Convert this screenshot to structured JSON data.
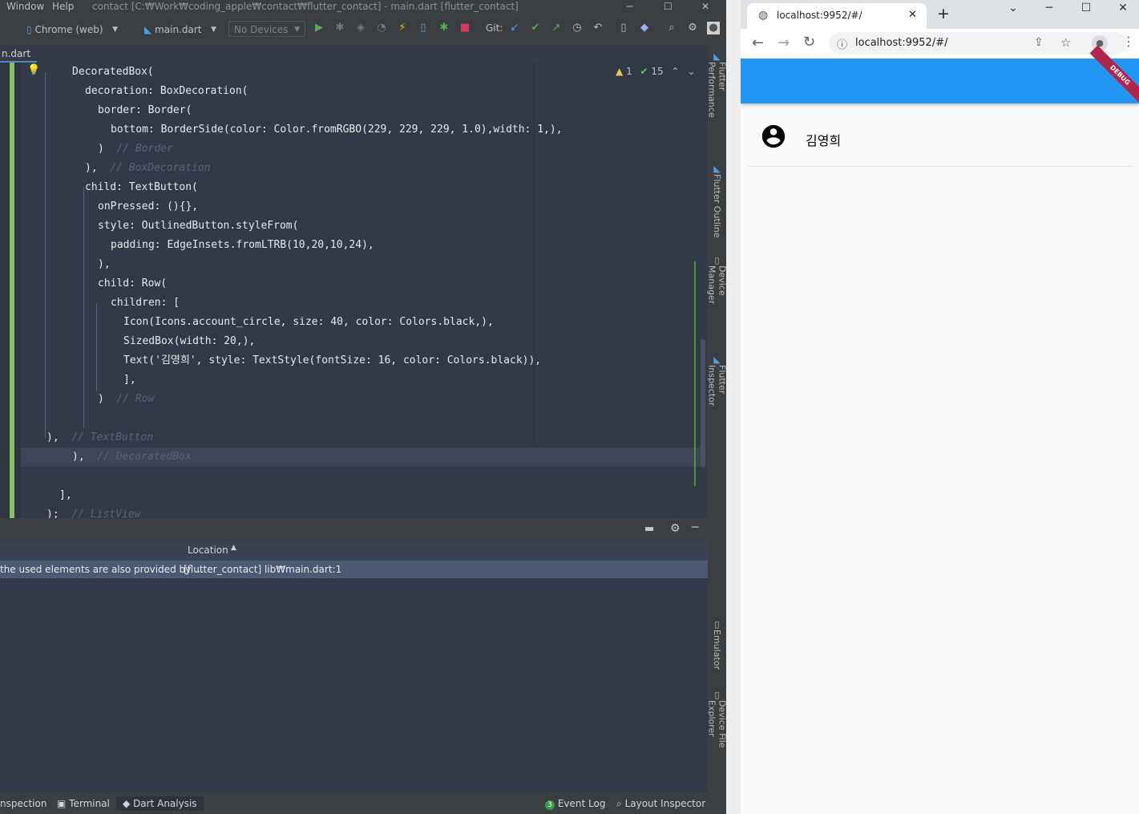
{
  "ide": {
    "menu": [
      "Window",
      "Help"
    ],
    "window_title": "contact [C:₩Work₩coding_apple₩contact₩flutter_contact] - main.dart [flutter_contact]",
    "toolbar": {
      "device_target": "Chrome (web)",
      "run_config": "main.dart",
      "devices": "No Devices",
      "git_label": "Git:"
    },
    "tab_name": "n.dart",
    "inspection": {
      "warnings": "1",
      "checks": "15"
    },
    "code_lines": [
      {
        "code": "DecoratedBox(",
        "comment": ""
      },
      {
        "code": "decoration: BoxDecoration(",
        "comment": ""
      },
      {
        "code": "border: Border(",
        "comment": ""
      },
      {
        "code": "bottom: BorderSide(color: Color.fromRGBO(229, 229, 229, 1.0),width: 1,),",
        "comment": ""
      },
      {
        "code": ")",
        "comment": "// Border"
      },
      {
        "code": "),",
        "comment": "// BoxDecoration"
      },
      {
        "code": "child: TextButton(",
        "comment": ""
      },
      {
        "code": "onPressed: (){},",
        "comment": ""
      },
      {
        "code": "style: OutlinedButton.styleFrom(",
        "comment": ""
      },
      {
        "code": "padding: EdgeInsets.fromLTRB(10,20,10,24),",
        "comment": ""
      },
      {
        "code": "),",
        "comment": ""
      },
      {
        "code": "child: Row(",
        "comment": ""
      },
      {
        "code": "children: [",
        "comment": ""
      },
      {
        "code": "Icon(Icons.account_circle, size: 40, color: Colors.black,),",
        "comment": ""
      },
      {
        "code": "SizedBox(width: 20,),",
        "comment": ""
      },
      {
        "code": "Text('김영희', style: TextStyle(fontSize: 16, color: Colors.black)),",
        "comment": ""
      },
      {
        "code": "],",
        "comment": ""
      },
      {
        "code": ")",
        "comment": "// Row"
      },
      {
        "code": "",
        "comment": ""
      },
      {
        "code": "),",
        "comment": "// TextButton"
      },
      {
        "code": "),",
        "comment": "// DecoratedBox"
      },
      {
        "code": "",
        "comment": ""
      },
      {
        "code": "],",
        "comment": ""
      },
      {
        "code": ");",
        "comment": "// ListView"
      }
    ],
    "right_tools": [
      "Flutter Performance",
      "Flutter Outline",
      "Device Manager",
      "Flutter Inspector",
      "Emulator",
      "Device File Explorer"
    ],
    "panel": {
      "column_header": "Location",
      "row_text": "the used elements are also provided by ...",
      "row_location": "[flutter_contact] lib₩main.dart:1"
    },
    "status": {
      "inspection": "nspection",
      "terminal": "Terminal",
      "dart_analysis": "Dart Analysis",
      "event_log": "Event Log",
      "event_count": "3",
      "layout_inspector": "Layout Inspector"
    }
  },
  "browser": {
    "tab_title": "localhost:9952/#/",
    "url": "localhost:9952/#/",
    "debug_banner": "DEBUG",
    "list_item_name": "김영희",
    "colors": {
      "appbar": "#2196f3",
      "debug": "#b0274a"
    }
  }
}
